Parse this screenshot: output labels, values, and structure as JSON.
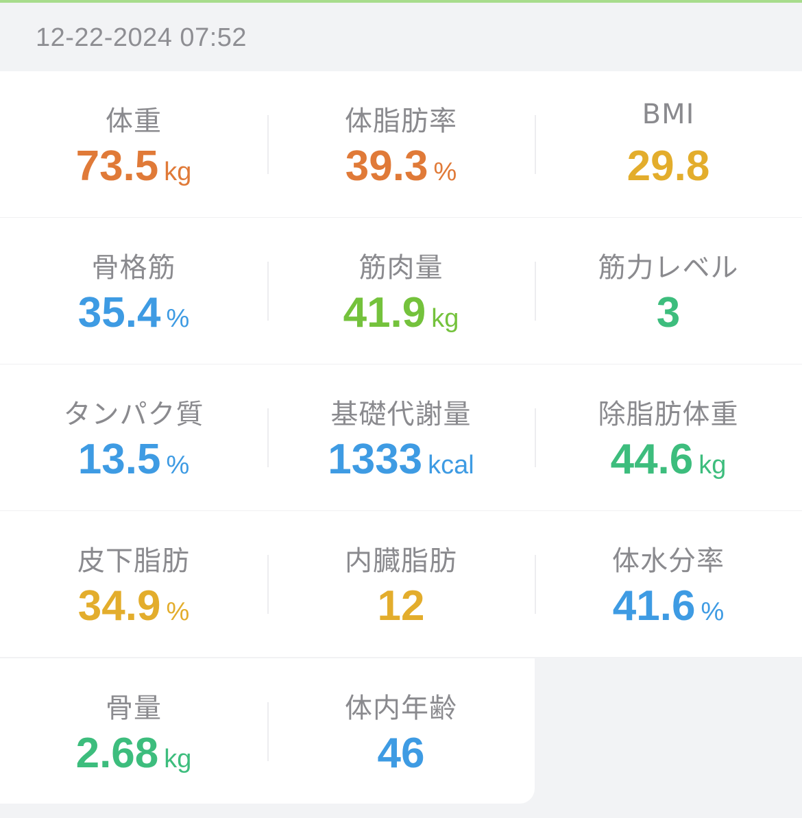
{
  "header": {
    "timestamp": "12-22-2024 07:52"
  },
  "colors": {
    "orange": "#e07a38",
    "amber": "#e3ad2c",
    "blue": "#3e9be3",
    "lime": "#74c23c",
    "green": "#3dbd7d",
    "label": "#8a8a8e",
    "accent_bar": "#a8dc8c"
  },
  "metrics": [
    [
      {
        "label": "体重",
        "value": "73.5",
        "unit": "kg",
        "color": "#e07a38"
      },
      {
        "label": "体脂肪率",
        "value": "39.3",
        "unit": "%",
        "color": "#e07a38"
      },
      {
        "label": "BMI",
        "value": "29.8",
        "unit": "",
        "color": "#e3ad2c"
      }
    ],
    [
      {
        "label": "骨格筋",
        "value": "35.4",
        "unit": "%",
        "color": "#3e9be3"
      },
      {
        "label": "筋肉量",
        "value": "41.9",
        "unit": "kg",
        "color": "#74c23c"
      },
      {
        "label": "筋力レベル",
        "value": "3",
        "unit": "",
        "color": "#3dbd7d"
      }
    ],
    [
      {
        "label": "タンパク質",
        "value": "13.5",
        "unit": "%",
        "color": "#3e9be3"
      },
      {
        "label": "基礎代謝量",
        "value": "1333",
        "unit": "kcal",
        "color": "#3e9be3"
      },
      {
        "label": "除脂肪体重",
        "value": "44.6",
        "unit": "kg",
        "color": "#3dbd7d"
      }
    ],
    [
      {
        "label": "皮下脂肪",
        "value": "34.9",
        "unit": "%",
        "color": "#e3ad2c"
      },
      {
        "label": "内臓脂肪",
        "value": "12",
        "unit": "",
        "color": "#e3ad2c"
      },
      {
        "label": "体水分率",
        "value": "41.6",
        "unit": "%",
        "color": "#3e9be3"
      }
    ],
    [
      {
        "label": "骨量",
        "value": "2.68",
        "unit": "kg",
        "color": "#3dbd7d"
      },
      {
        "label": "体内年齢",
        "value": "46",
        "unit": "",
        "color": "#3e9be3"
      }
    ]
  ]
}
